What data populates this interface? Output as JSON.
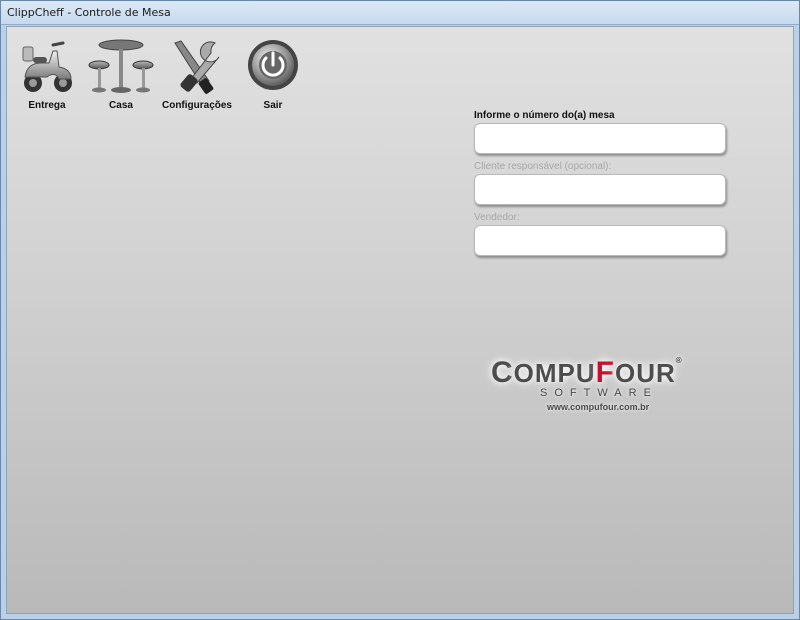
{
  "window": {
    "title": "ClippCheff - Controle de Mesa"
  },
  "toolbar": {
    "items": [
      {
        "label": "Entrega",
        "icon": "scooter-icon"
      },
      {
        "label": "Casa",
        "icon": "table-stools-icon"
      },
      {
        "label": "Configurações",
        "icon": "tools-icon"
      },
      {
        "label": "Sair",
        "icon": "power-icon"
      }
    ]
  },
  "form": {
    "mesa_label": "Informe o número do(a) mesa",
    "mesa_value": "",
    "cliente_label": "Cliente responsável (opcional):",
    "cliente_value": "",
    "vendedor_label": "Vendedor:",
    "vendedor_value": ""
  },
  "logo": {
    "brand_part1_initial": "C",
    "brand_part1_rest": "OMPU",
    "brand_part2_initial": "F",
    "brand_part2_rest": "OUR",
    "reg": "®",
    "sub": "SOFTWARE",
    "url": "www.compufour.com.br"
  },
  "colors": {
    "brand_red": "#c8102e",
    "brand_gray": "#4d4d4d"
  }
}
